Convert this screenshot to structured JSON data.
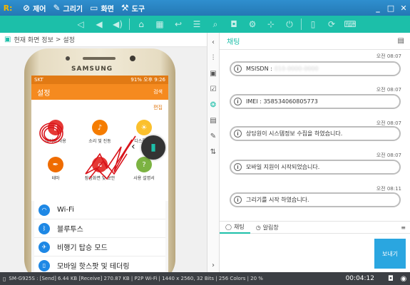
{
  "titlebar": {
    "logo": "R:",
    "menus": [
      {
        "icon": "control-icon",
        "label": "제어"
      },
      {
        "icon": "draw-icon",
        "label": "그리기"
      },
      {
        "icon": "screen-icon",
        "label": "화면"
      },
      {
        "icon": "tools-icon",
        "label": "도구"
      }
    ]
  },
  "breadcrumb": {
    "root": "현재 화면 정보",
    "sep": ">",
    "current": "설정"
  },
  "phone": {
    "brand": "SAMSUNG",
    "status_left": "SKT",
    "status_right": "91% 오후 9:26",
    "title": "설정",
    "search": "검색",
    "edit": "편집",
    "grid": [
      {
        "label": "데이터 사용",
        "color": "#e53935"
      },
      {
        "label": "소리 및 진동",
        "color": "#f57c00"
      },
      {
        "label": "디스플레이",
        "color": "#fbc02d"
      },
      {
        "label": "테마",
        "color": "#ef6c00"
      },
      {
        "label": "잠금화면 및 보안",
        "color": "#e53935"
      },
      {
        "label": "사용 설명서",
        "color": "#7cb342"
      }
    ],
    "list": [
      {
        "icon": "wifi-icon",
        "label": "Wi-Fi"
      },
      {
        "icon": "bluetooth-icon",
        "label": "블루투스"
      },
      {
        "icon": "airplane-icon",
        "label": "비행기 탑승 모드"
      },
      {
        "icon": "hotspot-icon",
        "label": "모바일 핫스팟 및 테더링"
      }
    ]
  },
  "chat": {
    "title": "채팅",
    "messages": [
      {
        "time": "오전 08:07",
        "text": "MSISDN :",
        "blurred": "010-0000-0000"
      },
      {
        "time": "오전 08:07",
        "text": "IMEI : 358534060805773"
      },
      {
        "time": "오전 08:07",
        "text": "상담원이 시스템정보 수집을 하였습니다."
      },
      {
        "time": "오전 08:07",
        "text": "모바일 지원이 시작되었습니다."
      },
      {
        "time": "오전 08:11",
        "text": "그리기를 시작 하였습니다."
      }
    ],
    "tabs": [
      {
        "label": "채팅",
        "active": true
      },
      {
        "label": "알림창",
        "active": false
      }
    ],
    "send_label": "보내기"
  },
  "bottombar": {
    "info": "SM-G925S : [Send] 6.44 KB  [Receive] 270.87 KB | P2P Wi-Fi | 1440 x 2560, 32 Bits | 256 Colors | 20 %",
    "timer": "00:04:12"
  }
}
